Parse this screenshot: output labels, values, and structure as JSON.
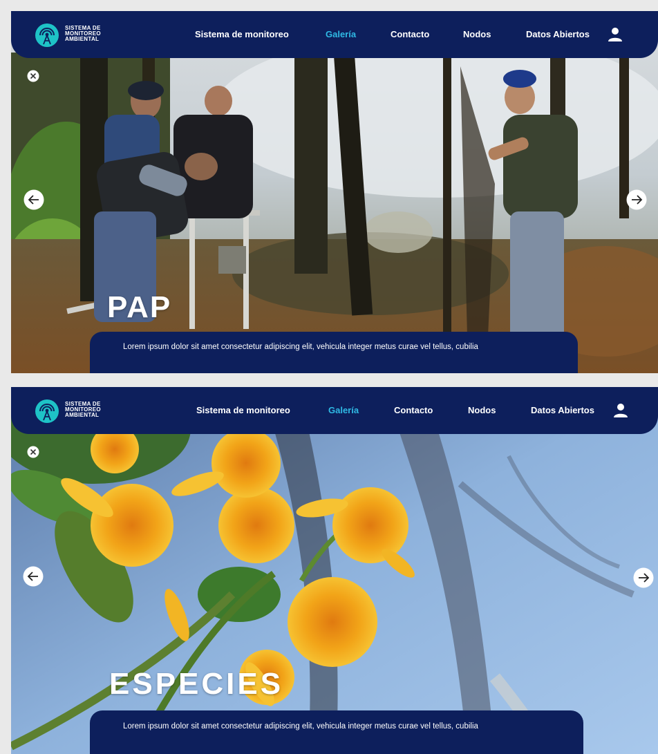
{
  "logo": {
    "line1": "SISTEMA DE",
    "line2": "MONITOREO",
    "line3": "AMBIENTAL"
  },
  "nav": {
    "items": [
      "Sistema de monitoreo",
      "Galería",
      "Contacto",
      "Nodos",
      "Datos Abiertos"
    ],
    "active": "Galería"
  },
  "slides": [
    {
      "title": "PAP",
      "caption": "Lorem ipsum dolor sit amet consectetur adipiscing elit, vehicula integer metus curae vel tellus, cubilia"
    },
    {
      "title": "ESPECIES",
      "caption": "Lorem ipsum dolor sit amet consectetur adipiscing elit, vehicula integer metus curae vel tellus, cubilia"
    }
  ],
  "icons": {
    "logo": "radio-tower-logo-icon",
    "user": "user-icon",
    "close": "close-icon",
    "prev": "arrow-left-icon",
    "next": "arrow-right-icon"
  },
  "colors": {
    "navbar": "#0d1f5c",
    "accent": "#2fb9e4",
    "logo": "#1ec3c7"
  }
}
